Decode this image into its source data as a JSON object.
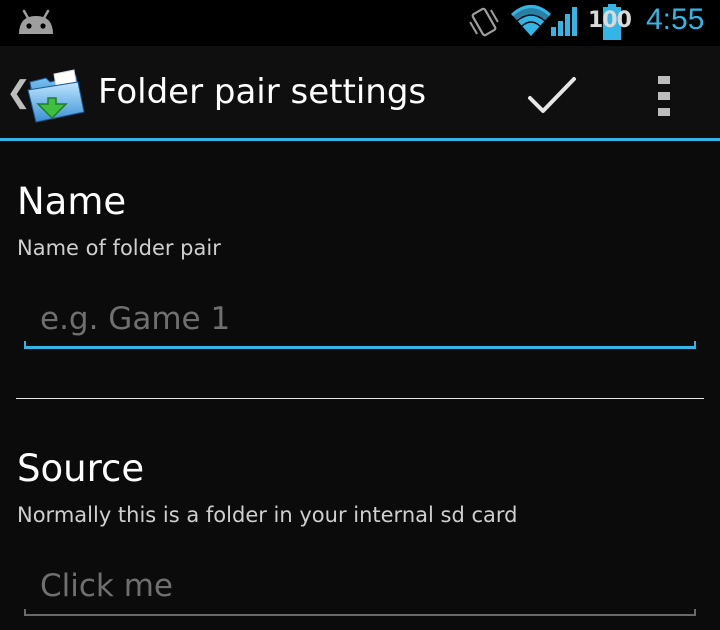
{
  "status_bar": {
    "notification_icon": "android-robot-icon",
    "vibrate_icon": "vibrate-icon",
    "wifi_icon": "wifi-icon",
    "signal_icon": "cell-signal-icon",
    "battery_icon": "battery-icon",
    "battery_level": "100",
    "time": "4:55",
    "accent_color": "#33b5e5"
  },
  "action_bar": {
    "up_icon": "chevron-left-icon",
    "app_icon": "folder-sync-icon",
    "title": "Folder pair settings",
    "done_icon": "checkmark-icon",
    "overflow_icon": "overflow-menu-icon"
  },
  "form": {
    "name": {
      "label": "Name",
      "description": "Name of folder pair",
      "placeholder": "e.g. Game 1",
      "value": ""
    },
    "source": {
      "label": "Source",
      "description": "Normally this is a folder in your internal sd card",
      "placeholder": "Click me",
      "value": ""
    }
  }
}
